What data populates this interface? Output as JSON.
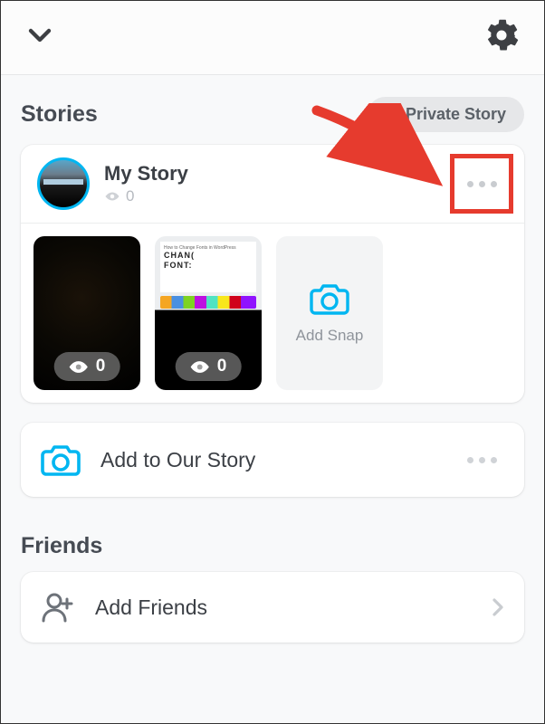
{
  "header": {},
  "stories": {
    "title": "Stories",
    "private_button": "Private Story",
    "my_story": {
      "title": "My Story",
      "views": "0"
    },
    "snaps": [
      {
        "views": "0"
      },
      {
        "views": "0"
      }
    ],
    "add_snap_label": "Add Snap",
    "our_story_label": "Add to Our Story"
  },
  "friends": {
    "title": "Friends",
    "add_label": "Add Friends"
  }
}
